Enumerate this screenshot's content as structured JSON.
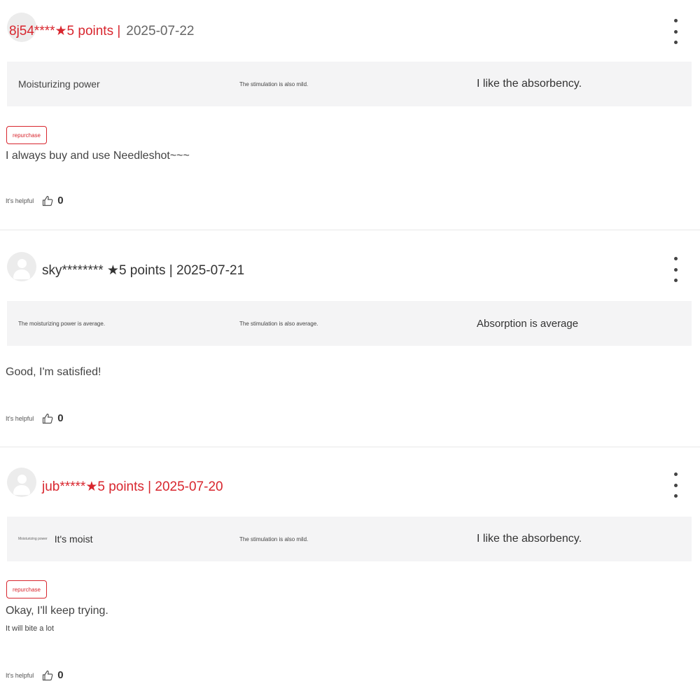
{
  "reviews": [
    {
      "author": "8j54****★5 points |",
      "date": "2025-07-22",
      "attributes": [
        "Moisturizing power",
        "The stimulation is also mild.",
        "I like the absorbency."
      ],
      "badge": "repurchase",
      "content": "I always buy and use Needleshot~~~",
      "sub": "",
      "helpful_label": "It's helpful",
      "helpful_count": "0"
    },
    {
      "author": "sky******** ★5 points | 2025-07-21",
      "date": "",
      "attributes": [
        "The moisturizing power is average.",
        "The stimulation is also average.",
        "Absorption is average"
      ],
      "badge": "",
      "content": "Good, I'm satisfied!",
      "sub": "",
      "helpful_label": "It's helpful",
      "helpful_count": "0"
    },
    {
      "author": "jub*****★5 points | 2025-07-20",
      "date": "",
      "attributes": [
        "Moisturizing power",
        "It's moist",
        "The stimulation is also mild.",
        "I like the absorbency."
      ],
      "badge": "repurchase",
      "content": "Okay, I'll keep trying.",
      "sub": "It will bite a lot",
      "helpful_label": "It's helpful",
      "helpful_count": "0"
    }
  ],
  "icons": {
    "avatar": "user-avatar-icon",
    "more": "more-vertical-icon",
    "thumb": "thumbs-up-icon"
  },
  "colors": {
    "accent": "#d8262e",
    "attribute_bg": "#f4f4f5",
    "divider": "#e8e8e8"
  }
}
